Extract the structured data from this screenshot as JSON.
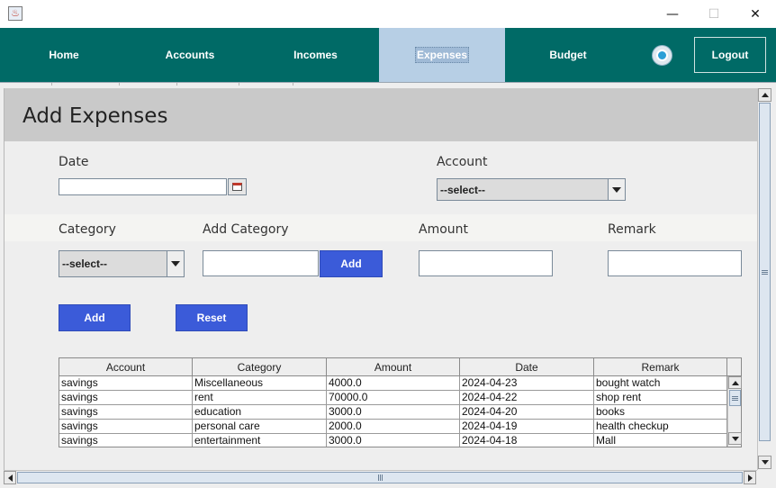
{
  "window": {
    "title": "",
    "app_icon": "java-cup-icon",
    "controls": {
      "minimize": "—",
      "maximize": "☐",
      "close": "✕"
    }
  },
  "nav": {
    "items": [
      {
        "label": "Home"
      },
      {
        "label": "Accounts"
      },
      {
        "label": "Incomes"
      },
      {
        "label": "Expenses",
        "active": true
      },
      {
        "label": "Budget"
      }
    ],
    "user_icon": "user-profile-icon",
    "logout_label": "Logout",
    "colors": {
      "bar": "#006a66",
      "active": "#b7cfe5"
    }
  },
  "page": {
    "title": "Add Expenses"
  },
  "form": {
    "date_label": "Date",
    "date_value": "",
    "calendar_icon": "calendar-icon",
    "account_label": "Account",
    "account_selected": "--select--",
    "category_label": "Category",
    "category_selected": "--select--",
    "add_category_label": "Add Category",
    "add_category_value": "",
    "add_category_button": "Add",
    "amount_label": "Amount",
    "amount_value": "",
    "remark_label": "Remark",
    "remark_value": "",
    "add_button": "Add",
    "reset_button": "Reset",
    "button_color": "#3b5bd9"
  },
  "table": {
    "columns": [
      "Account",
      "Category",
      "Amount",
      "Date",
      "Remark"
    ],
    "rows": [
      [
        "savings",
        "Miscellaneous",
        "4000.0",
        "2024-04-23",
        "bought watch"
      ],
      [
        "savings",
        "rent",
        "70000.0",
        "2024-04-22",
        "shop rent"
      ],
      [
        "savings",
        "education",
        "3000.0",
        "2024-04-20",
        "books"
      ],
      [
        "savings",
        "personal care",
        "2000.0",
        "2024-04-19",
        "health checkup"
      ],
      [
        "savings",
        "entertainment",
        "3000.0",
        "2024-04-18",
        "Mall"
      ]
    ]
  }
}
